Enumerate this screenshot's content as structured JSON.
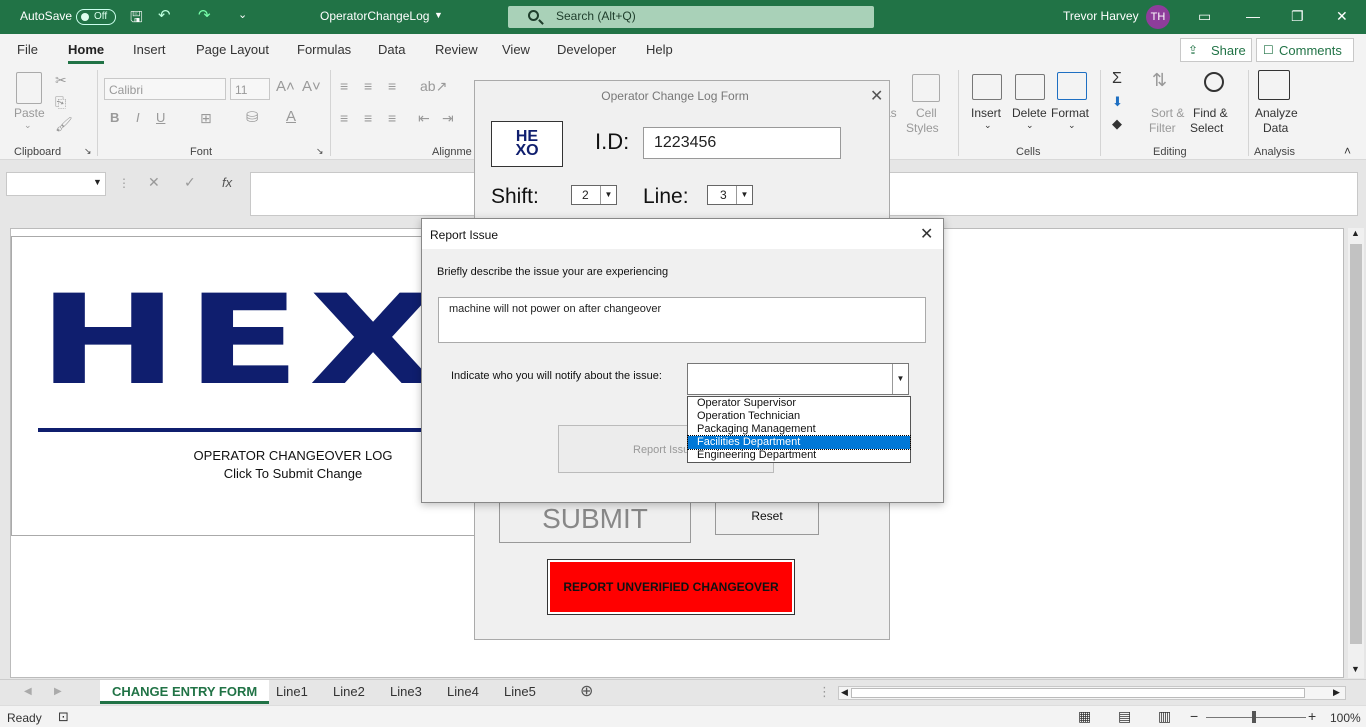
{
  "titlebar": {
    "autosave": "AutoSave",
    "autosave_state": "Off",
    "file_name": "OperatorChangeLog",
    "search_placeholder": "Search (Alt+Q)",
    "user_name": "Trevor Harvey",
    "user_initials": "TH"
  },
  "ribbon": {
    "tabs": [
      "File",
      "Home",
      "Insert",
      "Page Layout",
      "Formulas",
      "Data",
      "Review",
      "View",
      "Developer",
      "Help"
    ],
    "share": "Share",
    "comments": "Comments",
    "font_name": "Calibri",
    "font_size": "11",
    "paste": "Paste",
    "groups": {
      "clipboard": "Clipboard",
      "font": "Font",
      "alignment": "Alignme",
      "cells": "Cells",
      "editing": "Editing",
      "analysis": "Analysis"
    },
    "cell_styles": [
      "Cell",
      "Styles"
    ],
    "insert": "Insert",
    "delete": "Delete",
    "format": "Format",
    "sort_filter": [
      "Sort &",
      "Filter"
    ],
    "find_select": [
      "Find &",
      "Select"
    ],
    "analyze_data": [
      "Analyze",
      "Data"
    ],
    "partial_as": "as"
  },
  "sheet": {
    "logo_text": "HEX",
    "changeover_title": "OPERATOR CHANGEOVER LOG",
    "changeover_sub": "Click To Submit Change"
  },
  "operator_form": {
    "title": "Operator Change Log Form",
    "logo_text_top": "HE",
    "logo_text_bottom": "XO",
    "id_label": "I.D:",
    "id_value": "1223456",
    "shift_label": "Shift:",
    "shift_value": "2",
    "line_label": "Line:",
    "line_value": "3",
    "submit": "SUBMIT",
    "reset": "Reset",
    "report_unverified": "REPORT UNVERIFIED CHANGEOVER"
  },
  "report_dialog": {
    "title": "Report Issue",
    "describe_label": "Briefly describe the issue your are experiencing",
    "issue_text": "machine will not power on after changeover",
    "notify_label": "Indicate who you will notify about the issue:",
    "notify_value": "",
    "report_button": "Report Issu",
    "options": [
      "Operator Supervisor",
      "Operation Technician",
      "Packaging Management",
      "Facilities Department",
      "Engineering Department"
    ],
    "selected_option": "Facilities Department"
  },
  "sheet_tabs": [
    "CHANGE ENTRY FORM",
    "Line1",
    "Line2",
    "Line3",
    "Line4",
    "Line5"
  ],
  "status": {
    "ready": "Ready",
    "zoom": "100%"
  },
  "colors": {
    "excel_green": "#217346",
    "hexo_blue": "#0f1e6e",
    "report_red": "#ff0000",
    "selection_blue": "#0078d7"
  }
}
